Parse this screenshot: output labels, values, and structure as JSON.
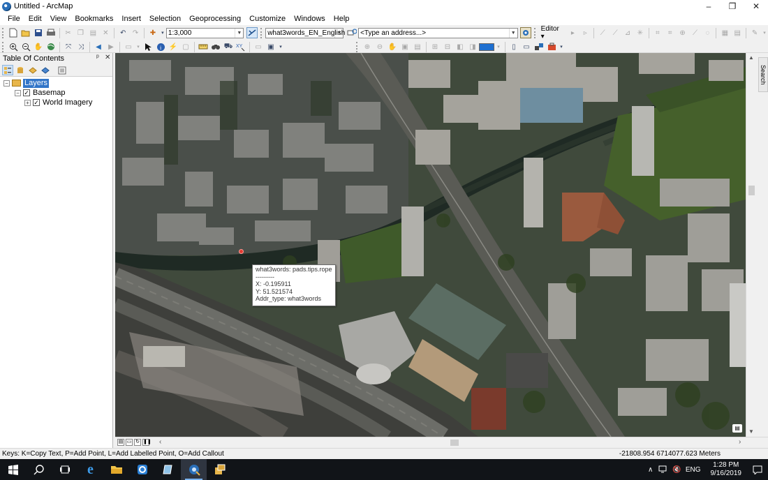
{
  "window": {
    "title": "Untitled - ArcMap",
    "controls": [
      "–",
      "❐",
      "✕"
    ]
  },
  "menu": [
    "File",
    "Edit",
    "View",
    "Bookmarks",
    "Insert",
    "Selection",
    "Geoprocessing",
    "Customize",
    "Windows",
    "Help"
  ],
  "toolbar": {
    "scale": "1:3,000",
    "locator": "what3words_EN_English",
    "address_placeholder": "<Type an address...>",
    "editor_label": "Editor ▾"
  },
  "toc": {
    "title": "Table Of Contents",
    "pin": "ᵖ",
    "close": "✕",
    "root": "Layers",
    "group": "Basemap",
    "layer": "World Imagery"
  },
  "side_tab": "Search",
  "popup": {
    "line1": "what3words: pads.tips.rope",
    "line2": "---------",
    "line3": "X: -0.195911",
    "line4": "Y: 51.521574",
    "line5": "Addr_type: what3words"
  },
  "status": {
    "keys": "Keys: K=Copy Text, P=Add Point, L=Add Labelled Point, O=Add Callout",
    "coords": "-21808.954  6714077.623 Meters"
  },
  "taskbar": {
    "lang": "ENG",
    "time": "1:28 PM",
    "date": "9/16/2019"
  },
  "colors": {
    "accent": "#3275c8",
    "map_water": "#1f2a24",
    "map_green": "#3f5a2a",
    "marker": "#e23b32"
  }
}
